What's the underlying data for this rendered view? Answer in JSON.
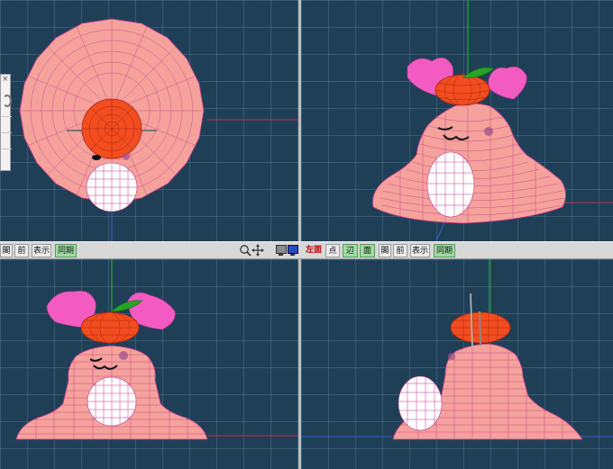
{
  "toolbar": {
    "left_group": {
      "b1": "閣",
      "b2": "前",
      "b3": "表示",
      "b4": "同期"
    },
    "view_label": "左面",
    "right_group": {
      "b1": "点",
      "b2": "辺",
      "b3": "面",
      "b4": "閣",
      "b5": "前",
      "b6": "表示",
      "b7": "同期"
    },
    "icons": [
      "zoom-icon",
      "move-icon",
      "screen-layout-icon"
    ]
  },
  "side_panel": {
    "close_glyph": "×"
  },
  "colors": {
    "viewport_bg": "#1f3f57",
    "body_pink": "#f4a29b",
    "wire": "#c0368a",
    "tangerine": "#f24d1f",
    "ears": "#f25cc2",
    "leaf": "#26a426",
    "belly": "#ffffff",
    "axis_green": "#22c722",
    "axis_red": "#c0304a",
    "axis_blue": "#3a5fd0"
  }
}
